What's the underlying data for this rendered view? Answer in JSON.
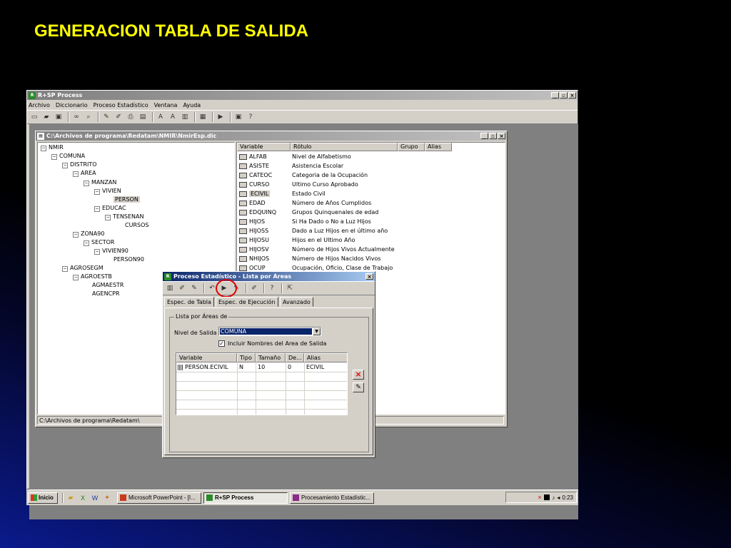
{
  "slide_title": "GENERACION TABLA DE SALIDA",
  "app": {
    "title": "R+SP Process",
    "menu": [
      "Archivo",
      "Diccionario",
      "Proceso Estadístico",
      "Ventana",
      "Ayuda"
    ]
  },
  "dict_window": {
    "title": "C:\\Archivos de programa\\Redatam\\NMIR\\NmirEsp.dic",
    "status": "C:\\Archivos de programa\\Redatam\\",
    "tree": [
      "NMIR",
      "COMUNA",
      "DISTRITO",
      "AREA",
      "MANZAN",
      "VIVIEN",
      "PERSON",
      "EDUCAC",
      "TENSENAN",
      "CURSOS",
      "ZONA90",
      "SECTOR",
      "VIVIEN90",
      "PERSON90",
      "AGROSEGM",
      "AGROESTB",
      "AGMAESTR",
      "AGENCPR"
    ],
    "columns": [
      "Variable",
      "Rótulo",
      "Grupo",
      "Alias"
    ],
    "variables": [
      {
        "name": "ALFAB",
        "label": "Nivel de Alfabetismo"
      },
      {
        "name": "ASISTE",
        "label": "Asistencia Escolar"
      },
      {
        "name": "CATEOC",
        "label": "Categoria de la Ocupación"
      },
      {
        "name": "CURSO",
        "label": "Ultimo Curso Aprobado"
      },
      {
        "name": "ECIVIL",
        "label": "Estado Civil"
      },
      {
        "name": "EDAD",
        "label": "Número de Años Cumplidos"
      },
      {
        "name": "EDQUINQ",
        "label": "Grupos Quinquenales de edad"
      },
      {
        "name": "HIJOS",
        "label": "Si Ha Dado o No a Luz Hijos"
      },
      {
        "name": "HIJOSS",
        "label": "Dado a Luz Hijos en el último año"
      },
      {
        "name": "HIJOSU",
        "label": "Hijos en el Ultimo Año"
      },
      {
        "name": "HIJOSV",
        "label": "Número de Hijos Vivos Actualmente"
      },
      {
        "name": "NHIJOS",
        "label": "Número de Hijos Nacidos Vivos"
      },
      {
        "name": "OCUP",
        "label": "Ocupación, Oficio, Clase de Trabajo"
      }
    ]
  },
  "dialog": {
    "title": "Proceso Estadístico - Lista por Áreas",
    "tabs": [
      "Espec. de Tabla",
      "Espec. de Ejecución",
      "Avanzado"
    ],
    "group_label": "Lista por Áreas de",
    "nivel_label": "Nivel de Salida",
    "nivel_value": "COMUNA",
    "checkbox_label": "Incluir Nombres del Area de Salida",
    "grid_columns": [
      "Variable",
      "Tipo",
      "Tamaño",
      "De...",
      "Alias"
    ],
    "grid_row": {
      "variable": "PERSON.ECIVIL",
      "tipo": "N",
      "tamano": "10",
      "de": "0",
      "alias": "ECIVIL"
    }
  },
  "taskbar": {
    "start": "Inicio",
    "items": [
      "Microsoft PowerPoint - [I...",
      "R+SP Process",
      "Procesamiento Estadístic..."
    ],
    "clock": "0:23"
  },
  "colors": {
    "title_yellow": "#ffff00",
    "highlight_red": "#e00000",
    "selection_blue": "#0a246a"
  }
}
